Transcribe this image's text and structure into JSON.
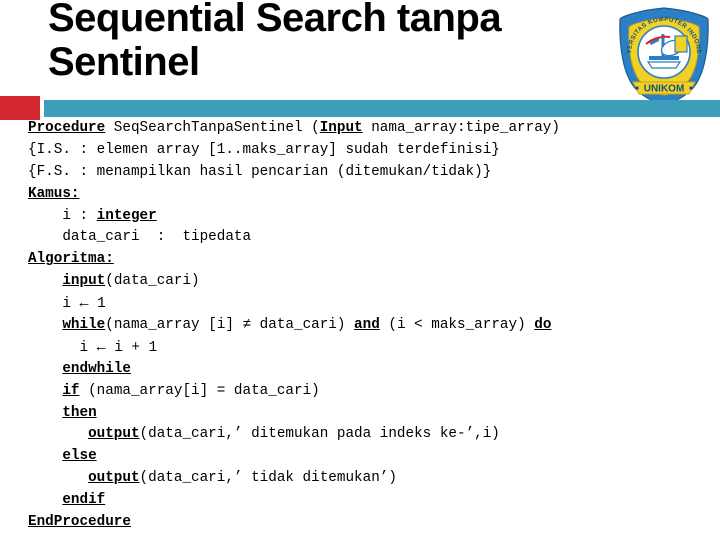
{
  "slide": {
    "title": "Sequential Search tanpa Sentinel",
    "title_line1": "Sequential Search tanpa",
    "title_line2": "Sentinel"
  },
  "logo": {
    "name": "unikom-logo",
    "outer_text": "UNIVERSITAS KOMPUTER INDONESIA",
    "banner_text": "UNIKOM",
    "colors": {
      "shield_fill": "#f2d024",
      "shield_border": "#1d7ec4",
      "ring": "#2b7fc4",
      "banner": "#f2d024",
      "accent_red": "#d8232a"
    }
  },
  "decor": {
    "red_bar_color": "#d22630",
    "teal_bar_color": "#3d9ebc"
  },
  "code": {
    "lines": [
      {
        "indent": 0,
        "segments": [
          {
            "text": "Procedure",
            "style": "kw"
          },
          {
            "text": " SeqSearchTanpaSentinel (",
            "style": "plain"
          },
          {
            "text": "Input",
            "style": "kw"
          },
          {
            "text": " nama_array:tipe_array)",
            "style": "plain"
          }
        ]
      },
      {
        "indent": 0,
        "segments": [
          {
            "text": "{I.S. : elemen array [1..maks_array] sudah terdefinisi}",
            "style": "plain"
          }
        ]
      },
      {
        "indent": 0,
        "segments": [
          {
            "text": "{F.S. : menampilkan hasil pencarian (ditemukan/tidak)}",
            "style": "plain"
          }
        ]
      },
      {
        "indent": 0,
        "segments": [
          {
            "text": "Kamus:",
            "style": "kw"
          }
        ]
      },
      {
        "indent": 4,
        "segments": [
          {
            "text": "i : ",
            "style": "plain"
          },
          {
            "text": "integer",
            "style": "kw"
          }
        ]
      },
      {
        "indent": 4,
        "segments": [
          {
            "text": "data_cari  :  tipedata",
            "style": "plain"
          }
        ]
      },
      {
        "indent": 0,
        "segments": [
          {
            "text": "Algoritma:",
            "style": "kw"
          }
        ]
      },
      {
        "indent": 4,
        "segments": [
          {
            "text": "input",
            "style": "kw"
          },
          {
            "text": "(data_cari)",
            "style": "plain"
          }
        ]
      },
      {
        "indent": 4,
        "segments": [
          {
            "text": "i ",
            "style": "plain"
          },
          {
            "text": "←",
            "style": "arrow"
          },
          {
            "text": " 1",
            "style": "plain"
          }
        ]
      },
      {
        "indent": 4,
        "segments": [
          {
            "text": "while",
            "style": "kw"
          },
          {
            "text": "(nama_array [i] ≠ data_cari) ",
            "style": "plain"
          },
          {
            "text": "and",
            "style": "kw"
          },
          {
            "text": " (i < maks_array) ",
            "style": "plain"
          },
          {
            "text": "do",
            "style": "kw"
          }
        ]
      },
      {
        "indent": 6,
        "segments": [
          {
            "text": "i ",
            "style": "plain"
          },
          {
            "text": "←",
            "style": "arrow"
          },
          {
            "text": " i + 1",
            "style": "plain"
          }
        ]
      },
      {
        "indent": 4,
        "segments": [
          {
            "text": "endwhile",
            "style": "kw"
          }
        ]
      },
      {
        "indent": 4,
        "segments": [
          {
            "text": "if",
            "style": "kw"
          },
          {
            "text": " (nama_array[i] = data_cari)",
            "style": "plain"
          }
        ]
      },
      {
        "indent": 4,
        "segments": [
          {
            "text": "then",
            "style": "kw"
          }
        ]
      },
      {
        "indent": 7,
        "segments": [
          {
            "text": "output",
            "style": "kw"
          },
          {
            "text": "(data_cari,’ ditemukan pada indeks ke-’,i)",
            "style": "plain"
          }
        ]
      },
      {
        "indent": 4,
        "segments": [
          {
            "text": "else",
            "style": "kw"
          }
        ]
      },
      {
        "indent": 7,
        "segments": [
          {
            "text": "output",
            "style": "kw"
          },
          {
            "text": "(data_cari,’ tidak ditemukan’)",
            "style": "plain"
          }
        ]
      },
      {
        "indent": 4,
        "segments": [
          {
            "text": "endif",
            "style": "kw"
          }
        ]
      },
      {
        "indent": 0,
        "segments": [
          {
            "text": "EndProcedure",
            "style": "kw"
          }
        ]
      }
    ]
  }
}
